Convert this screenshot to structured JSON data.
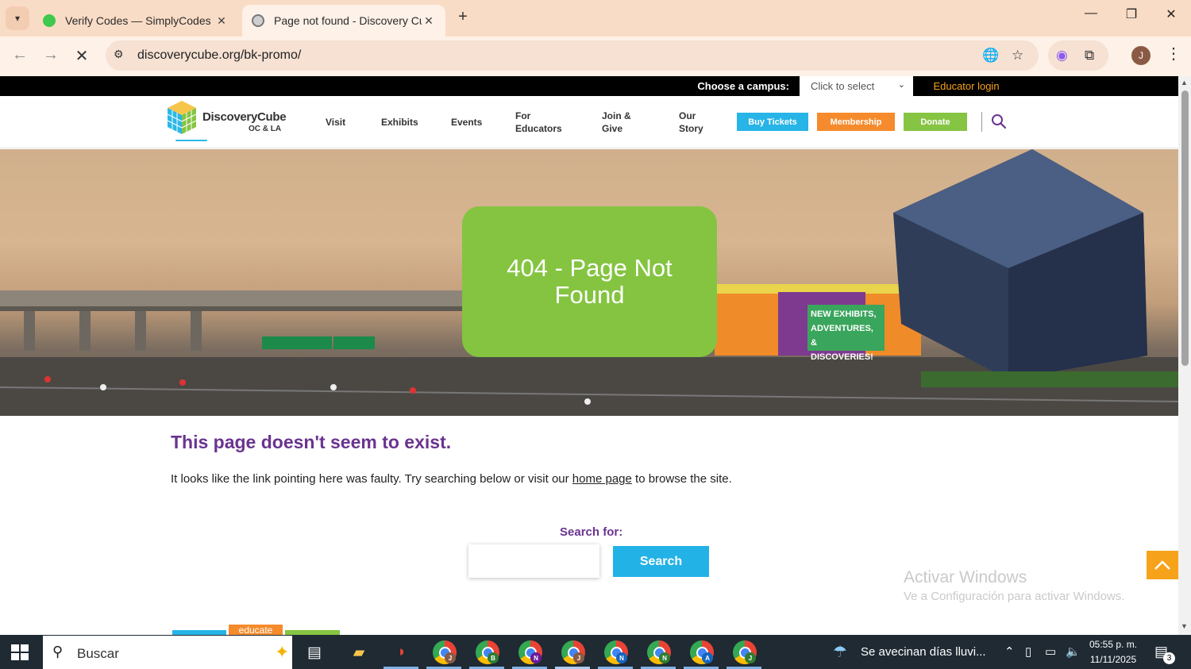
{
  "browser": {
    "tabs": [
      {
        "title": "Verify Codes — SimplyCodes",
        "icon": "simplycodes-favicon"
      },
      {
        "title": "Page not found - Discovery Cube",
        "icon": "discoverycube-favicon"
      }
    ],
    "url": "discoverycube.org/bk-promo/"
  },
  "site": {
    "topbar": {
      "choose_label": "Choose a campus:",
      "campus_placeholder": "Click to select",
      "educator_login": "Educator login"
    },
    "logo": {
      "name": "DiscoveryCube",
      "sub": "OC & LA"
    },
    "nav": [
      {
        "line1": "Visit",
        "line2": ""
      },
      {
        "line1": "Exhibits",
        "line2": ""
      },
      {
        "line1": "Events",
        "line2": ""
      },
      {
        "line1": "For",
        "line2": "Educators"
      },
      {
        "line1": "Join &",
        "line2": "Give"
      },
      {
        "line1": "Our",
        "line2": "Story"
      }
    ],
    "buttons": {
      "tickets": "Buy Tickets",
      "membership": "Membership",
      "donate": "Donate"
    },
    "hero": {
      "heading": "404 - Page Not Found",
      "sign": [
        "NEW EXHIBITS,",
        "ADVENTURES,",
        "& DISCOVERIES!"
      ]
    },
    "error": {
      "title": "This page doesn't seem to exist.",
      "text_before": "It looks like the link pointing here was faulty. Try searching below or visit our ",
      "link": "home page",
      "text_after": " to browse the site."
    },
    "search": {
      "label": "Search for:",
      "value": "",
      "button": "Search"
    },
    "footer_tag": "educate"
  },
  "windows_watermark": {
    "title": "Activar Windows",
    "subtitle": "Ve a Configuración para activar Windows."
  },
  "taskbar": {
    "search_placeholder": "Buscar",
    "chrome_profiles": [
      "J",
      "B",
      "N",
      "J",
      "N",
      "N",
      "A",
      "J"
    ],
    "weather": "Se avecinan días lluvi...",
    "time": "05:55 p. m.",
    "date": "11/11/2025",
    "notification_count": "3"
  },
  "colors": {
    "accent_purple": "#6a3491",
    "hero_green": "#84c441",
    "tickets_blue": "#27b4e7",
    "membership_orange": "#f58b2c",
    "donate_green": "#86c443",
    "educator_orange": "#f7a21b"
  }
}
